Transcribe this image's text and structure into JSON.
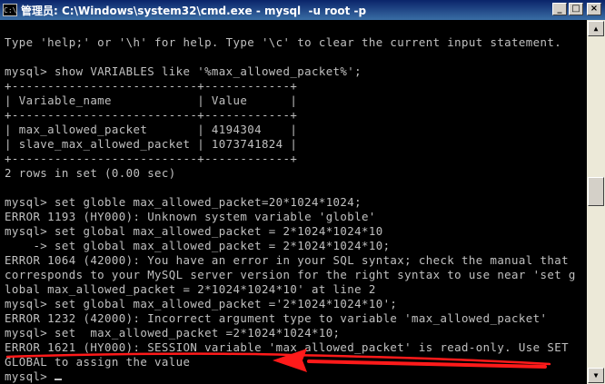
{
  "window": {
    "title": "管理员: C:\\Windows\\system32\\cmd.exe - mysql  -u root -p",
    "icon_text": "C:\\",
    "buttons": {
      "minimize": "_",
      "maximize": "□",
      "close": "×"
    }
  },
  "console": {
    "lines": [
      "",
      "Type 'help;' or '\\h' for help. Type '\\c' to clear the current input statement.",
      "",
      "mysql> show VARIABLES like '%max_allowed_packet%';",
      "+--------------------------+------------+",
      "| Variable_name            | Value      |",
      "+--------------------------+------------+",
      "| max_allowed_packet       | 4194304    |",
      "| slave_max_allowed_packet | 1073741824 |",
      "+--------------------------+------------+",
      "2 rows in set (0.00 sec)",
      "",
      "mysql> set globle max_allowed_packet=20*1024*1024;",
      "ERROR 1193 (HY000): Unknown system variable 'globle'",
      "mysql> set global max_allowed_packet = 2*1024*1024*10",
      "    -> set global max_allowed_packet = 2*1024*1024*10;",
      "ERROR 1064 (42000): You have an error in your SQL syntax; check the manual that",
      "corresponds to your MySQL server version for the right syntax to use near 'set g",
      "lobal max_allowed_packet = 2*1024*1024*10' at line 2",
      "mysql> set global max_allowed_packet ='2*1024*1024*10';",
      "ERROR 1232 (42000): Incorrect argument type to variable 'max_allowed_packet'",
      "mysql> set  max_allowed_packet =2*1024*1024*10;",
      "ERROR 1621 (HY000): SESSION variable 'max_allowed_packet' is read-only. Use SET",
      "GLOBAL to assign the value",
      "mysql> "
    ]
  },
  "colors": {
    "annotation": "#ff1a1a",
    "console_text": "#c0c0c0",
    "background": "#000000"
  }
}
